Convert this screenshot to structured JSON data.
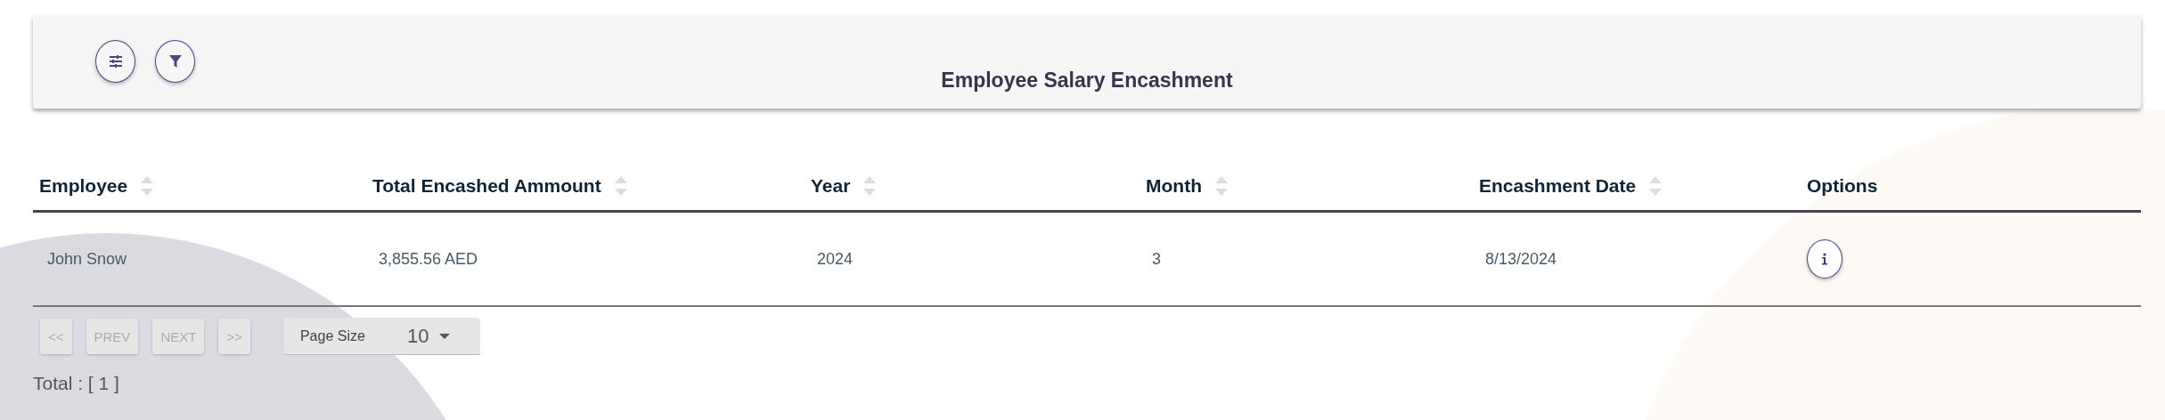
{
  "header": {
    "title": "Employee Salary Encashment"
  },
  "table": {
    "columns": [
      {
        "label": "Employee",
        "sortable": true
      },
      {
        "label": "Total Encashed Ammount",
        "sortable": true
      },
      {
        "label": "Year",
        "sortable": true
      },
      {
        "label": "Month",
        "sortable": true
      },
      {
        "label": "Encashment Date",
        "sortable": true
      },
      {
        "label": "Options",
        "sortable": false
      }
    ],
    "rows": [
      {
        "cells": [
          "John Snow",
          "3,855.56 AED",
          "2024",
          "3",
          "8/13/2024"
        ]
      }
    ]
  },
  "pagination": {
    "buttons": [
      {
        "label": "<<",
        "disabled": true
      },
      {
        "label": "PREV",
        "disabled": true
      },
      {
        "label": "NEXT",
        "disabled": true
      },
      {
        "label": ">>",
        "disabled": true
      }
    ],
    "page_size": {
      "label": "Page Size",
      "value": "10"
    }
  },
  "total": "Total : [ 1 ]"
}
